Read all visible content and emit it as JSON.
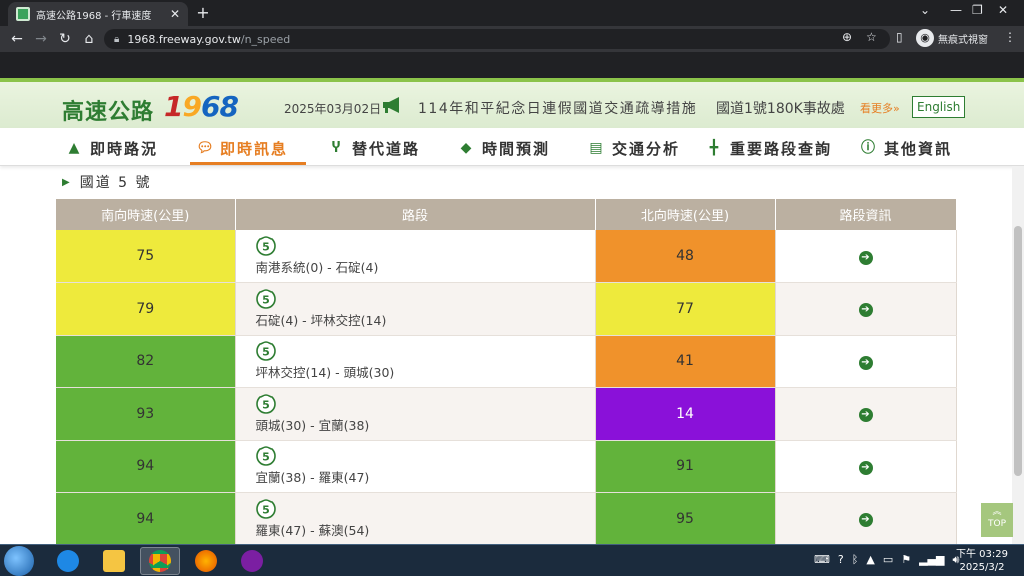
{
  "browser": {
    "tab_title": "高速公路1968 - 行車速度",
    "url_host": "1968.freeway.gov.tw",
    "url_path": "/n_speed",
    "profile_label": "無痕式視窗"
  },
  "header": {
    "logo_text": "高速公路",
    "logo_digits": [
      "1",
      "9",
      "6",
      "8"
    ],
    "date": "2025年03月02日",
    "news_1": "114年和平紀念日連假國道交通疏導措施",
    "news_2": "國道1號180K事故處",
    "more_link": "看更多»",
    "english_button": "English"
  },
  "nav": {
    "items": [
      {
        "label": "即時路況",
        "icon": "road-icon"
      },
      {
        "label": "即時訊息",
        "icon": "message-icon"
      },
      {
        "label": "替代道路",
        "icon": "route-icon"
      },
      {
        "label": "時間預測",
        "icon": "diamond-arrow-icon"
      },
      {
        "label": "交通分析",
        "icon": "monitor-icon"
      },
      {
        "label": "重要路段查詢",
        "icon": "signpost-icon"
      },
      {
        "label": "其他資訊",
        "icon": "info-icon"
      }
    ],
    "active_index": 1
  },
  "section": {
    "title": "國道 5 號"
  },
  "table": {
    "headers": [
      "南向時速(公里)",
      "路段",
      "北向時速(公里)",
      "路段資訊"
    ],
    "rows": [
      {
        "south": "75",
        "south_color": "#eeea3c",
        "segment": "南港系統(0) - 石碇(4)",
        "north": "48",
        "north_color": "#f0922b"
      },
      {
        "south": "79",
        "south_color": "#eeea3c",
        "segment": "石碇(4) - 坪林交控(14)",
        "north": "77",
        "north_color": "#eeea3c"
      },
      {
        "south": "82",
        "south_color": "#62b33b",
        "segment": "坪林交控(14) - 頭城(30)",
        "north": "41",
        "north_color": "#f0922b"
      },
      {
        "south": "93",
        "south_color": "#62b33b",
        "segment": "頭城(30) - 宜蘭(38)",
        "north": "14",
        "north_color": "#8a11d9"
      },
      {
        "south": "94",
        "south_color": "#62b33b",
        "segment": "宜蘭(38) - 羅東(47)",
        "north": "91",
        "north_color": "#62b33b"
      },
      {
        "south": "94",
        "south_color": "#62b33b",
        "segment": "羅東(47) - 蘇澳(54)",
        "north": "95",
        "north_color": "#62b33b"
      }
    ],
    "highway_badge": "5"
  },
  "top_button": "TOP",
  "taskbar": {
    "time_line1": "下午 03:29",
    "time_line2": "2025/3/2"
  }
}
